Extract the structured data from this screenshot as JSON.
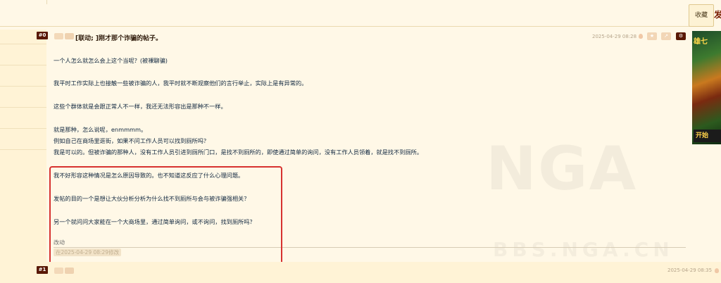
{
  "header": {
    "favorite_label": "收藏",
    "post_label": "发"
  },
  "post0": {
    "floor": "#0",
    "title": "[联动; ]刚才那个诈骗的帖子。",
    "time": "2025-04-29 08:28",
    "paragraphs": [
      "一个人怎么就怎么会上这个当呢？(被裸聊骗)",
      "我平时工作实际上也接触一些被诈骗的人，我平时就不断观察他们的言行举止，实际上是有异常的。",
      "这些个群体就是会跟正常人不一样，我还无法形容出是那种不一样。",
      "就是那种，怎么说呢，enmmmm。",
      "例如自己在商场里逛街，如果不问工作人员可以找到厕所吗？",
      "我是可以的。但被诈骗的那种人，没有工作人员引进到厕所门口，是找不到厕所的，即使通过简单的询问，没有工作人员领着，就是找不到厕所。",
      "我不好形容这种情况是怎么原因导致的。也不知道这反应了什么心理问题。",
      "发帖的目的一个是想让大伙分析分析为什么找不到厕所与会与被诈骗强相关？",
      "另一个就问问大家能在一个大商场里，通过简单询问，或不询问，找到厕所吗？"
    ],
    "edited_label": "改动",
    "edit_note": "在2025-04-29 08:29修改"
  },
  "post1": {
    "floor": "#1",
    "time": "2025-04-29 08:35"
  },
  "ad": {
    "logo_text": "雄七",
    "start_label": "开始"
  },
  "watermark": {
    "main": "NGA",
    "sub": "BBS.NGA.CN"
  },
  "colors": {
    "background": "#fff8e7",
    "floor_badge": "#591804",
    "highlight_box": "#d7322f",
    "text": "#10273f"
  }
}
